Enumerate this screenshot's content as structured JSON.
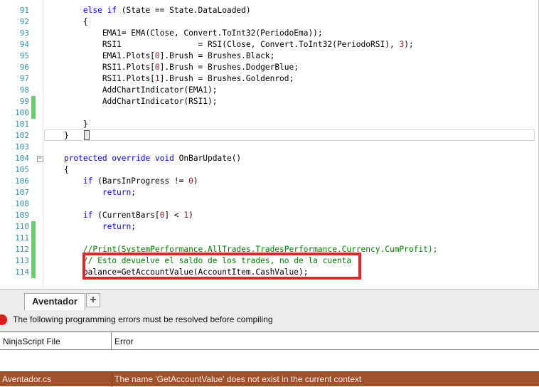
{
  "editor": {
    "lines": [
      {
        "n": "91",
        "tokens": [
          [
            "",
            "        "
          ],
          [
            "kw",
            "else if"
          ],
          [
            "",
            " (State == State.DataLoaded)"
          ]
        ]
      },
      {
        "n": "92",
        "tokens": [
          [
            "",
            "        {"
          ]
        ]
      },
      {
        "n": "93",
        "tokens": [
          [
            "",
            "            EMA1= EMA(Close, Convert.ToInt32(PeriodoEma));"
          ]
        ]
      },
      {
        "n": "94",
        "tokens": [
          [
            "",
            "            RSI1                = RSI(Close, Convert.ToInt32(PeriodoRSI), "
          ],
          [
            "num",
            "3"
          ],
          [
            "",
            ");"
          ]
        ]
      },
      {
        "n": "95",
        "tokens": [
          [
            "",
            "            EMA1.Plots["
          ],
          [
            "num",
            "0"
          ],
          [
            "",
            "].Brush = Brushes.Black;"
          ]
        ]
      },
      {
        "n": "96",
        "tokens": [
          [
            "",
            "            RSI1.Plots["
          ],
          [
            "num",
            "0"
          ],
          [
            "",
            "].Brush = Brushes.DodgerBlue;"
          ]
        ]
      },
      {
        "n": "97",
        "tokens": [
          [
            "",
            "            RSI1.Plots["
          ],
          [
            "num",
            "1"
          ],
          [
            "",
            "].Brush = Brushes.Goldenrod;"
          ]
        ]
      },
      {
        "n": "98",
        "tokens": [
          [
            "",
            "            AddChartIndicator(EMA1);"
          ]
        ]
      },
      {
        "n": "99",
        "tokens": [
          [
            "",
            "            AddChartIndicator(RSI1);"
          ]
        ]
      },
      {
        "n": "100",
        "tokens": [
          [
            "",
            ""
          ]
        ]
      },
      {
        "n": "101",
        "tokens": [
          [
            "",
            "        }"
          ]
        ]
      },
      {
        "n": "102",
        "tokens": [
          [
            "",
            "    }"
          ]
        ]
      },
      {
        "n": "103",
        "tokens": [
          [
            "",
            ""
          ]
        ]
      },
      {
        "n": "104",
        "tokens": [
          [
            "",
            "    "
          ],
          [
            "kw",
            "protected override void"
          ],
          [
            "",
            " OnBarUpdate()"
          ]
        ]
      },
      {
        "n": "105",
        "tokens": [
          [
            "",
            "    {"
          ]
        ]
      },
      {
        "n": "106",
        "tokens": [
          [
            "",
            "        "
          ],
          [
            "kw",
            "if"
          ],
          [
            "",
            " (BarsInProgress != "
          ],
          [
            "num",
            "0"
          ],
          [
            "",
            ")"
          ]
        ]
      },
      {
        "n": "107",
        "tokens": [
          [
            "",
            "            "
          ],
          [
            "kw",
            "return"
          ],
          [
            "",
            ";"
          ]
        ]
      },
      {
        "n": "108",
        "tokens": [
          [
            "",
            ""
          ]
        ]
      },
      {
        "n": "109",
        "tokens": [
          [
            "",
            "        "
          ],
          [
            "kw",
            "if"
          ],
          [
            "",
            " (CurrentBars["
          ],
          [
            "num",
            "0"
          ],
          [
            "",
            "] < "
          ],
          [
            "num",
            "1"
          ],
          [
            "",
            ")"
          ]
        ]
      },
      {
        "n": "110",
        "tokens": [
          [
            "",
            "            "
          ],
          [
            "kw",
            "return"
          ],
          [
            "",
            ";"
          ]
        ]
      },
      {
        "n": "111",
        "tokens": [
          [
            "",
            ""
          ]
        ]
      },
      {
        "n": "112",
        "tokens": [
          [
            "",
            "        "
          ],
          [
            "cm",
            "//Print(SystemPerformance.AllTrades.TradesPerformance.Currency.CumProfit);"
          ]
        ]
      },
      {
        "n": "113",
        "tokens": [
          [
            "",
            "        "
          ],
          [
            "cm",
            "// Esto devuelve el saldo de los trades, no de la cuenta"
          ]
        ]
      },
      {
        "n": "114",
        "tokens": [
          [
            "",
            "        balance=GetAccountValue(AccountItem.CashValue);"
          ]
        ]
      }
    ]
  },
  "tabs": [
    {
      "label": "Aventador"
    }
  ],
  "add_tab_label": "+",
  "errors": {
    "message": "The following programming errors must be resolved before compiling",
    "columns": [
      "NinjaScript File",
      "Error"
    ],
    "rows": [
      {
        "file": "Aventador.cs",
        "error": "The name 'GetAccountValue' does not exist in the current context"
      }
    ]
  },
  "colors": {
    "keyword": "#0000ff",
    "number": "#9a2020",
    "comment": "#008000",
    "line_number": "#2b91af",
    "error_row": "#a0522d",
    "annotation": "#e0262b"
  }
}
